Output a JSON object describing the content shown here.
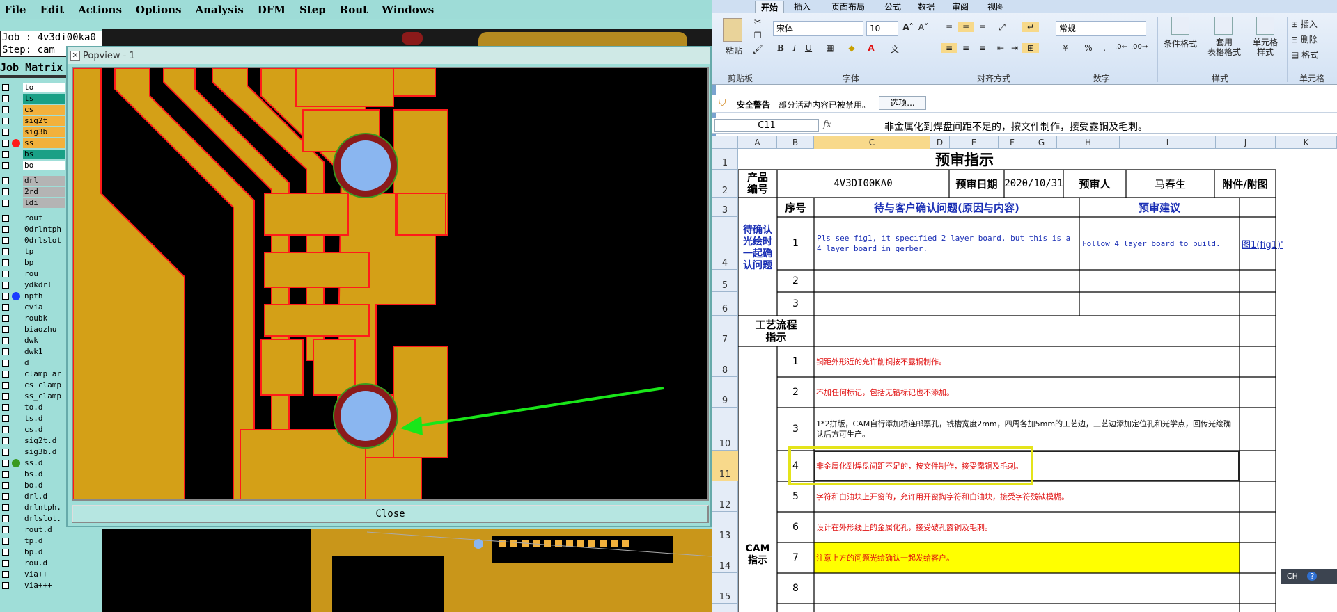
{
  "cam": {
    "menu": [
      "File",
      "Edit",
      "Actions",
      "Options",
      "Analysis",
      "DFM",
      "Step",
      "Rout",
      "Windows"
    ],
    "job_label": "Job : 4v3di00ka0",
    "step_label": "Step: cam",
    "job_matrix_title": "Job Matrix",
    "layers": [
      {
        "name": "to",
        "color": "#ffffff",
        "dot": ""
      },
      {
        "name": "ts",
        "color": "#1aa086",
        "dot": ""
      },
      {
        "name": "cs",
        "color": "#f2b13c",
        "dot": ""
      },
      {
        "name": "sig2t",
        "color": "#f2b13c",
        "dot": ""
      },
      {
        "name": "sig3b",
        "color": "#f2b13c",
        "dot": ""
      },
      {
        "name": "ss",
        "color": "#f2b13c",
        "dot": "#ff1a1a"
      },
      {
        "name": "bs",
        "color": "#1aa086",
        "dot": ""
      },
      {
        "name": "bo",
        "color": "#ffffff",
        "dot": ""
      },
      {
        "name": "drl",
        "color": "#b4b4b4",
        "dot": ""
      },
      {
        "name": "2rd",
        "color": "#b4b4b4",
        "dot": ""
      },
      {
        "name": "ldi",
        "color": "#b4b4b4",
        "dot": ""
      },
      {
        "name": "rout",
        "color": "#9fded8",
        "dot": ""
      },
      {
        "name": "0drlntph",
        "color": "#9fded8",
        "dot": ""
      },
      {
        "name": "0drlslot",
        "color": "#9fded8",
        "dot": ""
      },
      {
        "name": "tp",
        "color": "#9fded8",
        "dot": ""
      },
      {
        "name": "bp",
        "color": "#9fded8",
        "dot": ""
      },
      {
        "name": "rou",
        "color": "#9fded8",
        "dot": ""
      },
      {
        "name": "ydkdrl",
        "color": "#9fded8",
        "dot": ""
      },
      {
        "name": "npth",
        "color": "#9fded8",
        "dot": "#1a3cff"
      },
      {
        "name": "cvia",
        "color": "#9fded8",
        "dot": ""
      },
      {
        "name": "roubk",
        "color": "#9fded8",
        "dot": ""
      },
      {
        "name": "biaozhu",
        "color": "#9fded8",
        "dot": ""
      },
      {
        "name": "dwk",
        "color": "#9fded8",
        "dot": ""
      },
      {
        "name": "dwk1",
        "color": "#9fded8",
        "dot": ""
      },
      {
        "name": "d",
        "color": "#9fded8",
        "dot": ""
      },
      {
        "name": "clamp_ar",
        "color": "#9fded8",
        "dot": ""
      },
      {
        "name": "cs_clamp",
        "color": "#9fded8",
        "dot": ""
      },
      {
        "name": "ss_clamp",
        "color": "#9fded8",
        "dot": ""
      },
      {
        "name": "to.d",
        "color": "#9fded8",
        "dot": ""
      },
      {
        "name": "ts.d",
        "color": "#9fded8",
        "dot": ""
      },
      {
        "name": "cs.d",
        "color": "#9fded8",
        "dot": ""
      },
      {
        "name": "sig2t.d",
        "color": "#9fded8",
        "dot": ""
      },
      {
        "name": "sig3b.d",
        "color": "#9fded8",
        "dot": ""
      },
      {
        "name": "ss.d",
        "color": "#9fded8",
        "dot": "#3a9a20"
      },
      {
        "name": "bs.d",
        "color": "#9fded8",
        "dot": ""
      },
      {
        "name": "bo.d",
        "color": "#9fded8",
        "dot": ""
      },
      {
        "name": "drl.d",
        "color": "#9fded8",
        "dot": ""
      },
      {
        "name": "drlntph.",
        "color": "#9fded8",
        "dot": ""
      },
      {
        "name": "drlslot.",
        "color": "#9fded8",
        "dot": ""
      },
      {
        "name": "rout.d",
        "color": "#9fded8",
        "dot": ""
      },
      {
        "name": "tp.d",
        "color": "#9fded8",
        "dot": ""
      },
      {
        "name": "bp.d",
        "color": "#9fded8",
        "dot": ""
      },
      {
        "name": "rou.d",
        "color": "#9fded8",
        "dot": ""
      },
      {
        "name": "via++",
        "color": "#9fded8",
        "dot": ""
      },
      {
        "name": "via+++",
        "color": "#9fded8",
        "dot": ""
      }
    ],
    "popup_title": "Popview - 1",
    "close_label": "Close",
    "colors": {
      "copper": "#d4a017",
      "outline": "#ff1a1a",
      "pad_ring": "#8b1a1a",
      "drill": "#8ab6f0",
      "arrow": "#19e619"
    }
  },
  "excel": {
    "tabs": [
      "开始",
      "插入",
      "页面布局",
      "公式",
      "数据",
      "审阅",
      "视图"
    ],
    "ribbon": {
      "paste": "粘贴",
      "font_name": "宋体",
      "font_size": "10",
      "number_format": "常规",
      "conditional_format": "条件格式",
      "table_format": "套用\n表格格式",
      "cell_style": "单元格\n样式",
      "insert": "插入",
      "delete": "删除",
      "format": "格式",
      "groups": [
        "剪贴板",
        "字体",
        "对齐方式",
        "数字",
        "样式",
        "单元格"
      ]
    },
    "security": {
      "title": "安全警告",
      "message": "部分活动内容已被禁用。",
      "options": "选项..."
    },
    "formula": {
      "cell_ref": "C11",
      "fx": "fx",
      "content": "非金属化到焊盘间距不足的，按文件制作，接受露铜及毛刺。"
    },
    "columns": [
      "A",
      "B",
      "C",
      "D",
      "E",
      "F",
      "G",
      "H",
      "I",
      "J",
      "K"
    ],
    "rows": [
      "1",
      "2",
      "3",
      "4",
      "5",
      "6",
      "7",
      "8",
      "9",
      "10",
      "11",
      "12",
      "13",
      "14",
      "15"
    ],
    "sheet": {
      "title": "预审指示",
      "product_label": "产品\n编号",
      "product_no": "4V3DI00KA0",
      "date_label": "预审日期",
      "date": "2020/10/31",
      "reviewer_label": "预审人",
      "reviewer": "马春生",
      "attach_label": "附件/附图",
      "seq_label": "序号",
      "issue_header": "待与客户确认问题(原因与内容)",
      "suggest_header": "预审建议",
      "confirm_label": "待确认\n光绘时\n一起确\n认问题",
      "issues": [
        {
          "no": "1",
          "issue": "Pls see fig1, it specified 2 layer board, but this is a 4 layer board in gerber.",
          "suggest": "Follow 4 layer board to build.",
          "attach": "图1(fig1)'"
        },
        {
          "no": "2",
          "issue": "",
          "suggest": "",
          "attach": ""
        },
        {
          "no": "3",
          "issue": "",
          "suggest": "",
          "attach": ""
        }
      ],
      "process_label": "工艺流程\n指示",
      "cam_label": "CAM\n指示",
      "cam_items": [
        {
          "no": "1",
          "text": "铜距外形近的允许削铜按不露铜制作。",
          "color": "#e01010",
          "highlight": ""
        },
        {
          "no": "2",
          "text": "不加任何标记，包括无铅标记也不添加。",
          "color": "#e01010",
          "highlight": ""
        },
        {
          "no": "3",
          "text": "1*2拼版，CAM自行添加桥连邮票孔，铣槽宽度2mm，四周各加5mm的工艺边，工艺边添加定位孔和光学点，回传光绘确认后方可生产。",
          "color": "#111111",
          "highlight": ""
        },
        {
          "no": "4",
          "text": "非金属化到焊盘间距不足的，按文件制作，接受露铜及毛刺。",
          "color": "#e01010",
          "highlight": ""
        },
        {
          "no": "5",
          "text": "字符和白油块上开窗的，允许用开窗掏字符和白油块，接受字符残缺模糊。",
          "color": "#e01010",
          "highlight": ""
        },
        {
          "no": "6",
          "text": "设计在外形线上的金属化孔，接受破孔露铜及毛刺。",
          "color": "#e01010",
          "highlight": ""
        },
        {
          "no": "7",
          "text": "注意上方的问题光绘确认一起发给客户。",
          "color": "#e01010",
          "highlight": "#ffff00"
        },
        {
          "no": "8",
          "text": "",
          "color": "#e01010",
          "highlight": ""
        }
      ]
    },
    "status_widget": "CH"
  }
}
